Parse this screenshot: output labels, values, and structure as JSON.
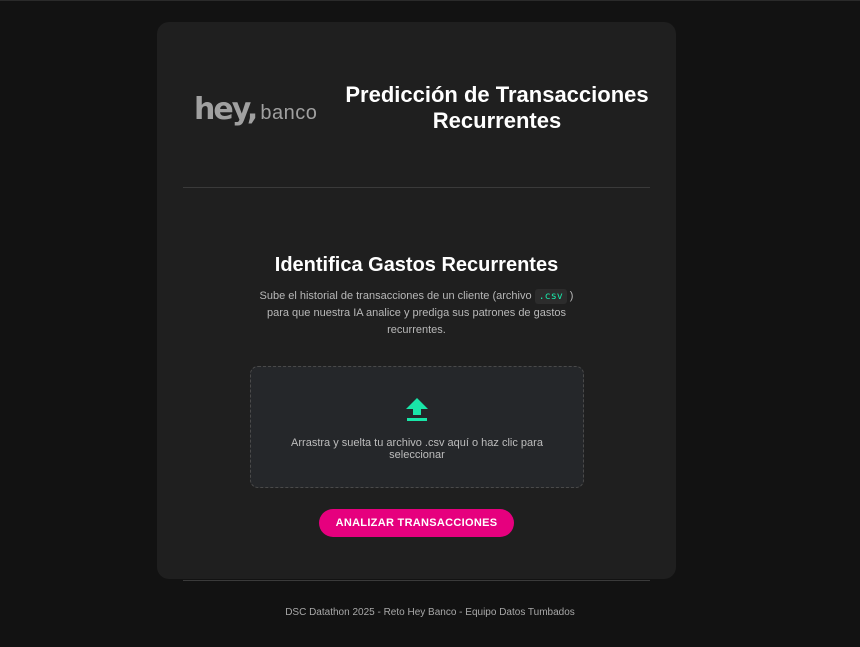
{
  "header": {
    "logo": {
      "hey": "hey,",
      "banco": "banco"
    },
    "title": "Predicción de Transacciones Recurrentes"
  },
  "main": {
    "section_title": "Identifica Gastos Recurrentes",
    "description_before": "Sube el historial de transacciones de un cliente (archivo ",
    "file_ext": ".csv",
    "description_after": " ) para que nuestra IA analice y prediga sus patrones de gastos recurrentes.",
    "dropzone": {
      "icon": "upload-icon",
      "text": "Arrastra y suelta tu archivo .csv aquí o haz clic para seleccionar"
    },
    "analyze_button": "ANALIZAR TRANSACCIONES"
  },
  "footer": {
    "text": "DSC Datathon 2025 - Reto Hey Banco - Equipo Datos Tumbados"
  },
  "colors": {
    "background": "#121212",
    "card": "#1f1f1f",
    "accent_green": "#19e6a8",
    "button_pink": "#e6007e"
  }
}
